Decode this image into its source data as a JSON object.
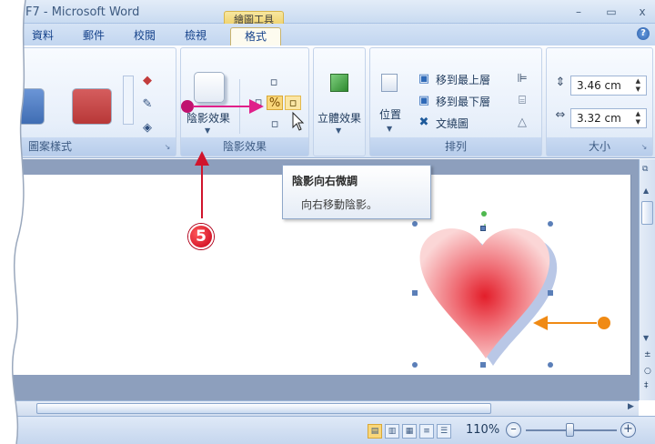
{
  "title": {
    "app": "F7 - Microsoft Word",
    "context_tools": "繪圖工具",
    "minimize": "–",
    "maximize": "▭",
    "close": "x"
  },
  "tabs": [
    {
      "label": "資料"
    },
    {
      "label": "郵件"
    },
    {
      "label": "校閱"
    },
    {
      "label": "檢視"
    },
    {
      "label": "格式"
    }
  ],
  "ribbon": {
    "shape_styles_label": "圖案樣式",
    "shadow_button": "陰影效果",
    "shadow_group_label": "陰影效果",
    "effects_3d": "立體效果",
    "position": "位置",
    "bring_front": "移到最上層",
    "send_back": "移到最下層",
    "text_wrap": "文繞圖",
    "arrange_label": "排列",
    "size_label": "大小",
    "height": "3.46 cm",
    "width": "3.32 cm"
  },
  "tooltip": {
    "title": "陰影向右微調",
    "description": "向右移動陰影。"
  },
  "callout": "5",
  "status": {
    "zoom": "110%",
    "zoom_minus": "–",
    "zoom_plus": "+"
  },
  "colors": {
    "swatch_blue": "#4f7fc4",
    "swatch_red": "#c9494a",
    "heart": "#f29a9e",
    "heart_core": "#e31e2a",
    "heart_shadow": "#b9c7e6",
    "arrow_pink": "#e0208a",
    "arrow_red": "#d0142c",
    "arrow_orange": "#f08a14"
  }
}
